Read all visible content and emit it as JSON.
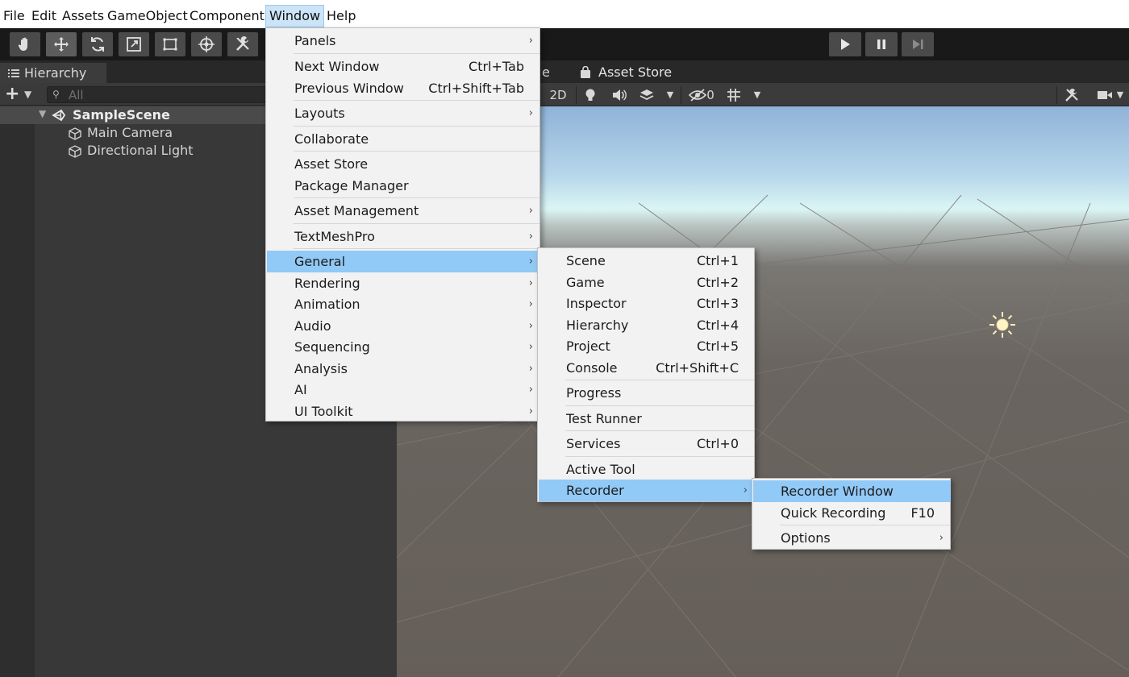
{
  "menubar": {
    "items": [
      "File",
      "Edit",
      "Assets",
      "GameObject",
      "Component",
      "Window",
      "Help"
    ],
    "active": "Window"
  },
  "toolbar": {
    "tools": [
      "hand-tool-icon",
      "move-tool-icon",
      "rotate-tool-icon",
      "scale-tool-icon",
      "rect-tool-icon",
      "transform-tool-icon",
      "custom-tool-icon"
    ],
    "playback": [
      "play-icon",
      "pause-icon",
      "step-icon"
    ]
  },
  "hierarchy": {
    "tab_label": "Hierarchy",
    "search_placeholder": "All",
    "scene_name": "SampleScene",
    "objects": [
      "Main Camera",
      "Directional Light"
    ]
  },
  "scene": {
    "tab_fragment": "e",
    "asset_store_tab": "Asset Store",
    "mode_2d": "2D",
    "hidden_count": "0"
  },
  "window_menu": {
    "items": [
      {
        "label": "Panels",
        "shortcut": "",
        "arrow": "›"
      },
      {
        "label": "Next Window",
        "shortcut": "Ctrl+Tab",
        "arrow": ""
      },
      {
        "label": "Previous Window",
        "shortcut": "Ctrl+Shift+Tab",
        "arrow": ""
      },
      {
        "label": "Layouts",
        "shortcut": "",
        "arrow": "›"
      },
      {
        "label": "Collaborate",
        "shortcut": "",
        "arrow": ""
      },
      {
        "label": "Asset Store",
        "shortcut": "",
        "arrow": ""
      },
      {
        "label": "Package Manager",
        "shortcut": "",
        "arrow": ""
      },
      {
        "label": "Asset Management",
        "shortcut": "",
        "arrow": "›"
      },
      {
        "label": "TextMeshPro",
        "shortcut": "",
        "arrow": "›"
      },
      {
        "label": "General",
        "shortcut": "",
        "arrow": "›"
      },
      {
        "label": "Rendering",
        "shortcut": "",
        "arrow": "›"
      },
      {
        "label": "Animation",
        "shortcut": "",
        "arrow": "›"
      },
      {
        "label": "Audio",
        "shortcut": "",
        "arrow": "›"
      },
      {
        "label": "Sequencing",
        "shortcut": "",
        "arrow": "›"
      },
      {
        "label": "Analysis",
        "shortcut": "",
        "arrow": "›"
      },
      {
        "label": "AI",
        "shortcut": "",
        "arrow": "›"
      },
      {
        "label": "UI Toolkit",
        "shortcut": "",
        "arrow": "›"
      }
    ]
  },
  "general_menu": {
    "items": [
      {
        "label": "Scene",
        "shortcut": "Ctrl+1",
        "arrow": ""
      },
      {
        "label": "Game",
        "shortcut": "Ctrl+2",
        "arrow": ""
      },
      {
        "label": "Inspector",
        "shortcut": "Ctrl+3",
        "arrow": ""
      },
      {
        "label": "Hierarchy",
        "shortcut": "Ctrl+4",
        "arrow": ""
      },
      {
        "label": "Project",
        "shortcut": "Ctrl+5",
        "arrow": ""
      },
      {
        "label": "Console",
        "shortcut": "Ctrl+Shift+C",
        "arrow": ""
      },
      {
        "label": "Progress",
        "shortcut": "",
        "arrow": ""
      },
      {
        "label": "Test Runner",
        "shortcut": "",
        "arrow": ""
      },
      {
        "label": "Services",
        "shortcut": "Ctrl+0",
        "arrow": ""
      },
      {
        "label": "Active Tool",
        "shortcut": "",
        "arrow": ""
      },
      {
        "label": "Recorder",
        "shortcut": "",
        "arrow": "›"
      }
    ]
  },
  "recorder_menu": {
    "items": [
      {
        "label": "Recorder Window",
        "shortcut": "",
        "arrow": ""
      },
      {
        "label": "Quick Recording",
        "shortcut": "F10",
        "arrow": ""
      },
      {
        "label": "Options",
        "shortcut": "",
        "arrow": "›"
      }
    ]
  },
  "colors": {
    "menu_highlight": "#91c9f7",
    "menubar_active": "#cce4f7",
    "menu_bg": "#f2f2f2",
    "panel_bg": "#383838"
  }
}
